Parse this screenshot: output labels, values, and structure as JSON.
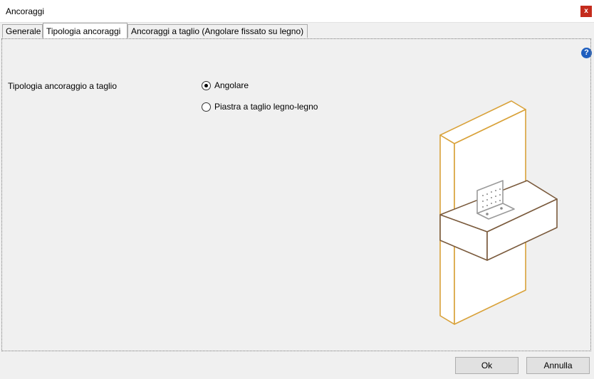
{
  "window": {
    "title": "Ancoraggi",
    "close_label": "x"
  },
  "tabs": [
    {
      "label": "Generale",
      "active": false
    },
    {
      "label": "Tipologia ancoraggi",
      "active": true
    },
    {
      "label": "Ancoraggi a taglio (Angolare fissato su legno)",
      "active": false
    }
  ],
  "help": {
    "label": "?"
  },
  "form": {
    "field_label": "Tipologia ancoraggio a taglio",
    "options": [
      {
        "label": "Angolare",
        "selected": true
      },
      {
        "label": "Piastra a taglio legno-legno",
        "selected": false
      }
    ]
  },
  "illustration": {
    "wall_color": "#d9a23a",
    "beam_color": "#7a5a3c",
    "bracket_color": "#9a9a9a"
  },
  "buttons": {
    "ok": "Ok",
    "cancel": "Annulla"
  }
}
